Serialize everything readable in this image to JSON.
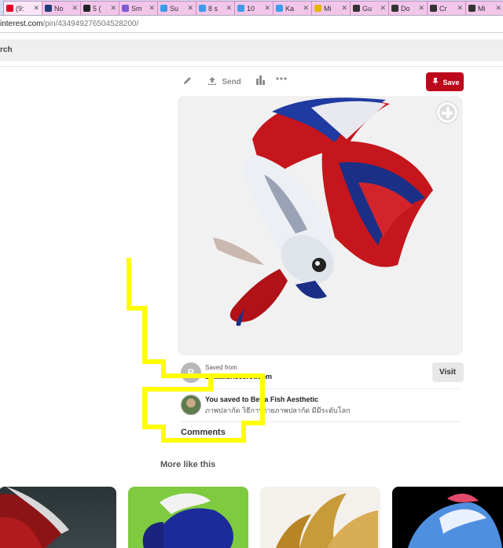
{
  "browser": {
    "tabs": [
      {
        "label": "(9:",
        "icon": "pinterest-icon",
        "color": "#e60023"
      },
      {
        "label": "No",
        "icon": "bp-icon",
        "color": "#1b3f7a"
      },
      {
        "label": "5 (",
        "icon": "tools-icon",
        "color": "#222222"
      },
      {
        "label": "Sm",
        "icon": "globe-icon",
        "color": "#7f5bd3"
      },
      {
        "label": "Su",
        "icon": "bird-icon",
        "color": "#3d9be9"
      },
      {
        "label": "8 s",
        "icon": "bird-icon",
        "color": "#3d9be9"
      },
      {
        "label": "10",
        "icon": "bird-icon",
        "color": "#3d9be9"
      },
      {
        "label": "Ka",
        "icon": "bird-icon",
        "color": "#3d9be9"
      },
      {
        "label": "Mi",
        "icon": "d-icon",
        "color": "#e5b700"
      },
      {
        "label": "Gu",
        "icon": "github-icon",
        "color": "#333333"
      },
      {
        "label": "Do",
        "icon": "github-icon",
        "color": "#333333"
      },
      {
        "label": "Cr",
        "icon": "github-icon",
        "color": "#333333"
      },
      {
        "label": "Mi",
        "icon": "github-icon",
        "color": "#333333"
      }
    ],
    "url_main": "interest.com",
    "url_path": "/pin/434949276504528200/",
    "search_text": "rch"
  },
  "pin": {
    "actions": {
      "edit_icon": "pencil-icon",
      "send_label": "Send",
      "send_icon": "upload-icon",
      "stats_icon": "bar-chart-icon",
      "more_icon": "ellipsis-icon",
      "save_label": "Save",
      "save_icon": "pin-icon",
      "save_color": "#bd081c"
    },
    "image_alt": "betta-fish",
    "source": {
      "avatar_letter": "B",
      "saved_from_label": "Saved from",
      "domain": "bettafishsecret.com",
      "visit_label": "Visit"
    },
    "saved_to": {
      "prefix": "You saved to",
      "board_name": "Betta Fish Aesthetic",
      "description": "ภาพปลากัด วิธีการถ่ายภาพปลากัด มีมีระดับโลก"
    },
    "comments_label": "Comments"
  },
  "more_like_this": {
    "heading": "More like this"
  },
  "annotation": {
    "color": "#ffff00"
  }
}
